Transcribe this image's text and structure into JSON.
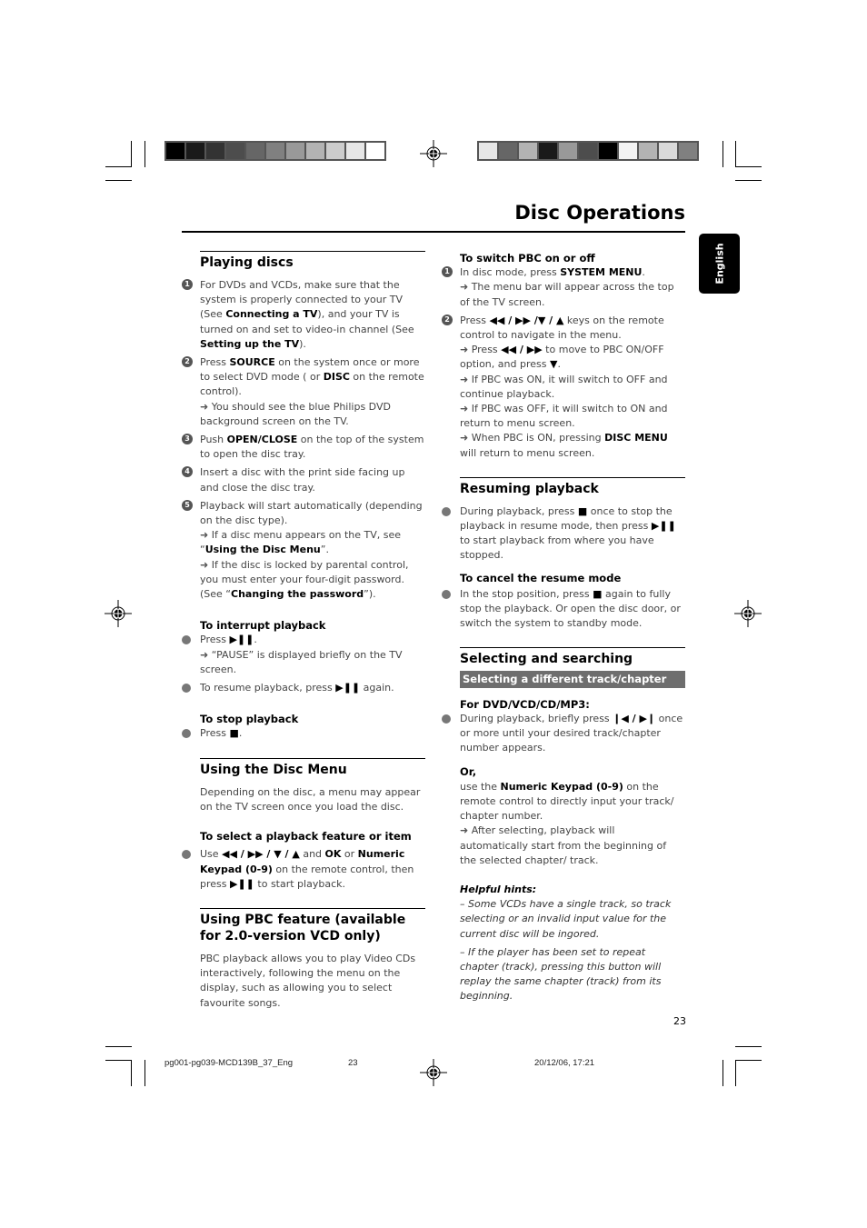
{
  "page": {
    "title": "Disc Operations",
    "language_tab": "English",
    "page_number": "23"
  },
  "colorbars": {
    "left": [
      "#000000",
      "#1a1a1a",
      "#333333",
      "#4d4d4d",
      "#666666",
      "#808080",
      "#999999",
      "#b3b3b3",
      "#cccccc",
      "#e6e6e6",
      "#ffffff"
    ],
    "right": [
      "#e6e6e6",
      "#666666",
      "#b3b3b3",
      "#1a1a1a",
      "#999999",
      "#4d4d4d",
      "#000000",
      "#f2f2f2",
      "#b3b3b3",
      "#d9d9d9",
      "#808080"
    ]
  },
  "left_column": {
    "playing_discs": {
      "heading": "Playing discs",
      "steps": [
        {
          "num": "1",
          "parts": [
            {
              "t": "For DVDs and VCDs, make sure that the system is properly connected to your TV (See "
            },
            {
              "b": "Connecting a TV"
            },
            {
              "t": "), and your TV is turned on and set to video-in channel (See "
            },
            {
              "b": "Setting up the TV"
            },
            {
              "t": ")."
            }
          ]
        },
        {
          "num": "2",
          "parts": [
            {
              "t": "Press "
            },
            {
              "b": "SOURCE"
            },
            {
              "t": " on the system once or more to select DVD mode ( or "
            },
            {
              "b": "DISC"
            },
            {
              "t": " on the remote control)."
            },
            {
              "br": 1
            },
            {
              "a": "➜"
            },
            {
              "t": " You should see the blue Philips DVD background screen on the TV."
            }
          ]
        },
        {
          "num": "3",
          "parts": [
            {
              "t": "Push "
            },
            {
              "b": "OPEN/CLOSE"
            },
            {
              "t": " on the top of the system to open the disc tray."
            }
          ]
        },
        {
          "num": "4",
          "parts": [
            {
              "t": "Insert a disc with the print side facing up and close the disc tray."
            }
          ]
        },
        {
          "num": "5",
          "parts": [
            {
              "t": "Playback will start automatically (depending on the disc type)."
            },
            {
              "br": 1
            },
            {
              "a": "➜"
            },
            {
              "t": " If a disc menu appears on the TV, see “"
            },
            {
              "b": "Using the Disc Menu"
            },
            {
              "t": "”."
            },
            {
              "br": 1
            },
            {
              "a": "➜"
            },
            {
              "t": " If the disc is locked by parental control, you must enter your four-digit password. (See “"
            },
            {
              "b": "Changing the password"
            },
            {
              "t": "”)."
            }
          ]
        }
      ]
    },
    "interrupt": {
      "heading": "To interrupt playback",
      "items": [
        {
          "parts": [
            {
              "t": "Press "
            },
            {
              "b": "▶❚❚"
            },
            {
              "t": "."
            },
            {
              "br": 1
            },
            {
              "a": "➜"
            },
            {
              "t": " “PAUSE” is displayed briefly on the TV screen."
            }
          ]
        },
        {
          "parts": [
            {
              "t": "To resume playback, press "
            },
            {
              "b": "▶❚❚"
            },
            {
              "t": " again."
            }
          ]
        }
      ]
    },
    "stop": {
      "heading": "To stop playback",
      "items": [
        {
          "parts": [
            {
              "t": "Press "
            },
            {
              "b": "■"
            },
            {
              "t": "."
            }
          ]
        }
      ]
    },
    "disc_menu": {
      "heading": "Using the Disc Menu",
      "intro": "Depending on the disc, a menu may appear on the TV screen once you load the disc.",
      "subheading": "To select a playback feature or item",
      "items": [
        {
          "parts": [
            {
              "t": "Use "
            },
            {
              "b": "◀◀ / ▶▶ / ▼ / ▲"
            },
            {
              "t": " and "
            },
            {
              "b": "OK"
            },
            {
              "t": " or "
            },
            {
              "b": "Numeric Keypad (0-9)"
            },
            {
              "t": " on the remote control, then press "
            },
            {
              "b": "▶❚❚"
            },
            {
              "t": " to start playback."
            }
          ]
        }
      ]
    },
    "pbc": {
      "heading": "Using PBC feature (available for 2.0-version VCD only)",
      "intro": "PBC playback allows you to play Video CDs interactively, following the menu on the display, such as allowing you to select favourite songs."
    }
  },
  "right_column": {
    "switch_pbc": {
      "heading": "To switch PBC on or off",
      "steps": [
        {
          "num": "1",
          "parts": [
            {
              "t": " In disc mode, press "
            },
            {
              "b": "SYSTEM MENU"
            },
            {
              "t": "."
            },
            {
              "br": 1
            },
            {
              "a": "➜"
            },
            {
              "t": " The menu bar will appear across the top of the TV screen."
            }
          ]
        },
        {
          "num": "2",
          "parts": [
            {
              "t": "Press "
            },
            {
              "b": "◀◀ / ▶▶ /▼ / ▲"
            },
            {
              "t": " keys on the remote control to navigate in the menu."
            },
            {
              "br": 1
            },
            {
              "a": "➜"
            },
            {
              "t": " Press "
            },
            {
              "b": "◀◀ / ▶▶"
            },
            {
              "t": " to move to PBC ON/OFF option, and press "
            },
            {
              "b": "▼"
            },
            {
              "t": "."
            },
            {
              "br": 1
            },
            {
              "a": "➜"
            },
            {
              "t": " If PBC was ON, it will switch to OFF and continue playback."
            },
            {
              "br": 1
            },
            {
              "a": "➜"
            },
            {
              "t": " If PBC was OFF, it will switch to ON and return to menu screen."
            },
            {
              "br": 1
            },
            {
              "a": "➜"
            },
            {
              "t": " When PBC is ON, pressing "
            },
            {
              "b": "DISC MENU"
            },
            {
              "t": " will return to menu screen."
            }
          ]
        }
      ]
    },
    "resuming": {
      "heading": "Resuming playback",
      "items": [
        {
          "parts": [
            {
              "t": "During playback, press "
            },
            {
              "b": "■"
            },
            {
              "t": " once to stop the playback in resume mode, then press "
            },
            {
              "b": "▶❚❚"
            },
            {
              "t": " to start playback from where you have stopped."
            }
          ]
        }
      ],
      "subheading": "To cancel the resume mode",
      "cancel_items": [
        {
          "parts": [
            {
              "t": "In the stop position, press "
            },
            {
              "b": "■"
            },
            {
              "t": " again to fully stop the playback. Or open the disc door, or switch the system to standby mode."
            }
          ]
        }
      ]
    },
    "selecting": {
      "heading": "Selecting and searching",
      "bar": "Selecting a different track/chapter",
      "subheading": "For DVD/VCD/CD/MP3:",
      "items": [
        {
          "parts": [
            {
              "t": "During playback, briefly press "
            },
            {
              "b": "❙◀ / ▶❙"
            },
            {
              "t": " once or more until your desired track/chapter number appears."
            }
          ]
        }
      ],
      "or_label": "Or,",
      "or_parts": [
        {
          "t": "use the "
        },
        {
          "b": "Numeric Keypad (0-9)"
        },
        {
          "t": " on the remote control to directly input your track/ chapter number."
        },
        {
          "br": 1
        },
        {
          "a": "➜"
        },
        {
          "t": " After selecting, playback will automatically start from the beginning of the selected chapter/ track."
        }
      ],
      "hints_label": "Helpful hints:",
      "hints": [
        "–  Some VCDs have a single track,  so track selecting or an invalid input value for the current disc will be ingored.",
        "–  If the player has been set to repeat chapter (track), pressing this button will replay the same chapter (track) from its beginning."
      ]
    }
  },
  "footer": {
    "file": "pg001-pg039-MCD139B_37_Eng",
    "page": "23",
    "datetime": "20/12/06, 17:21"
  }
}
